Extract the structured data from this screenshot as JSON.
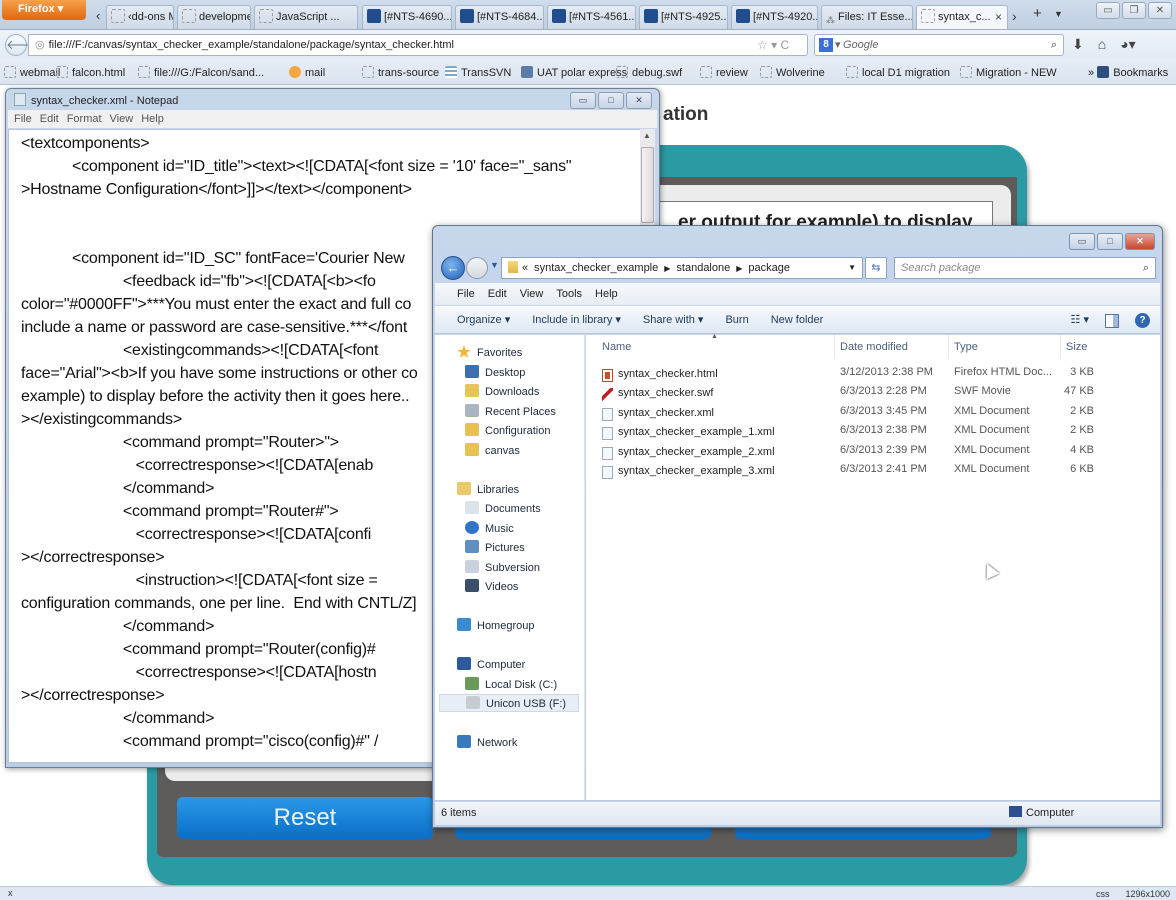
{
  "browser": {
    "menu_button": "Firefox",
    "tabs": [
      {
        "label": "‹dd-ons M...",
        "icon": "blank"
      },
      {
        "label": "developme...",
        "icon": "blank"
      },
      {
        "label": "JavaScript ...",
        "icon": "blank"
      },
      {
        "label": "[#NTS-4690...",
        "icon": "jira"
      },
      {
        "label": "[#NTS-4684...",
        "icon": "jira"
      },
      {
        "label": "[#NTS-4561...",
        "icon": "jira"
      },
      {
        "label": "[#NTS-4925...",
        "icon": "jira"
      },
      {
        "label": "[#NTS-4920...",
        "icon": "jira"
      },
      {
        "label": "Files: IT Esse...",
        "icon": "files"
      },
      {
        "label": "syntax_c...",
        "icon": "blank",
        "active": true
      }
    ],
    "tab_close": "×",
    "url": "file:///F:/canvas/syntax_checker_example/standalone/package/syntax_checker.html",
    "search_placeholder": "Google",
    "bookmarks": [
      {
        "label": "webmail",
        "icon": "blank"
      },
      {
        "label": "falcon.html",
        "icon": "blank"
      },
      {
        "label": "file:///G:/Falcon/sand...",
        "icon": "blank"
      },
      {
        "label": "mail",
        "icon": "colored"
      },
      {
        "label": "trans-source",
        "icon": "blank"
      },
      {
        "label": "TransSVN",
        "icon": "svn"
      },
      {
        "label": "UAT polar express",
        "icon": "uat"
      },
      {
        "label": "debug.swf",
        "icon": "blank"
      },
      {
        "label": "review",
        "icon": "blank"
      },
      {
        "label": "Wolverine",
        "icon": "blank"
      },
      {
        "label": "local D1 migration",
        "icon": "blank"
      },
      {
        "label": "Migration - NEW",
        "icon": "blank"
      }
    ],
    "bookmarks_menu": "Bookmarks",
    "status_left": "x",
    "status_right": [
      "css",
      "1296x1000"
    ]
  },
  "page": {
    "title_fragment": "ation",
    "text_fragment": "er output for example) to display",
    "buttons": [
      "Reset",
      "",
      ""
    ]
  },
  "notepad": {
    "title": "syntax_checker.xml - Notepad",
    "menu": [
      "File",
      "Edit",
      "Format",
      "View",
      "Help"
    ],
    "lines": [
      "<textcomponents>",
      "            <component id=\"ID_title\"><text><![CDATA[<font size = '10' face=\"_sans\"",
      ">Hostname Configuration</font>]]></text></component>",
      "",
      "",
      "            <component id=\"ID_SC\" fontFace='Courier New",
      "                        <feedback id=\"fb\"><![CDATA[<b><fo",
      "color=\"#0000FF\">***You must enter the exact and full co",
      "include a name or password are case-sensitive.***</font",
      "                        <existingcommands><![CDATA[<font",
      "face=\"Arial\"><b>If you have some instructions or other co",
      "example) to display before the activity then it goes here..",
      "></existingcommands>",
      "                        <command prompt=\"Router>\">",
      "                           <correctresponse><![CDATA[enab",
      "                        </command>",
      "                        <command prompt=\"Router#\">",
      "                           <correctresponse><![CDATA[confi",
      "></correctresponse>",
      "                           <instruction><![CDATA[<font size =",
      "configuration commands, one per line.  End with CNTL/Z]",
      "                        </command>",
      "                        <command prompt=\"Router(config)#",
      "                           <correctresponse><![CDATA[hostn",
      "></correctresponse>",
      "                        </command>",
      "                        <command prompt=\"cisco(config)#\" /"
    ]
  },
  "explorer": {
    "breadcrumb": [
      "«",
      "syntax_checker_example",
      "standalone",
      "package"
    ],
    "search_placeholder": "Search package",
    "menu": [
      "File",
      "Edit",
      "View",
      "Tools",
      "Help"
    ],
    "toolbar": [
      "Organize ▾",
      "Include in library ▾",
      "Share with ▾",
      "Burn",
      "New folder"
    ],
    "nav": [
      {
        "label": "Favorites",
        "icon": "star",
        "level": 0
      },
      {
        "label": "Desktop",
        "icon": "desktop",
        "level": 1
      },
      {
        "label": "Downloads",
        "icon": "downloads",
        "level": 1
      },
      {
        "label": "Recent Places",
        "icon": "recent",
        "level": 1
      },
      {
        "label": "Configuration",
        "icon": "folder",
        "level": 1
      },
      {
        "label": "canvas",
        "icon": "folder",
        "level": 1
      },
      {
        "label": "Libraries",
        "icon": "libraries",
        "level": 0,
        "gap": true
      },
      {
        "label": "Documents",
        "icon": "documents",
        "level": 1
      },
      {
        "label": "Music",
        "icon": "music",
        "level": 1
      },
      {
        "label": "Pictures",
        "icon": "pictures",
        "level": 1
      },
      {
        "label": "Subversion",
        "icon": "subversion",
        "level": 1
      },
      {
        "label": "Videos",
        "icon": "videos",
        "level": 1
      },
      {
        "label": "Homegroup",
        "icon": "homegroup",
        "level": 0,
        "gap": true
      },
      {
        "label": "Computer",
        "icon": "computer",
        "level": 0,
        "gap": true
      },
      {
        "label": "Local Disk (C:)",
        "icon": "disk",
        "level": 1
      },
      {
        "label": "Unicon USB  (F:)",
        "icon": "usb",
        "level": 1,
        "selected": true
      },
      {
        "label": "Network",
        "icon": "network",
        "level": 0,
        "gap": true
      }
    ],
    "columns": [
      "Name",
      "Date modified",
      "Type",
      "Size"
    ],
    "files": [
      {
        "name": "syntax_checker.html",
        "date": "3/12/2013 2:38 PM",
        "type": "Firefox HTML Doc...",
        "size": "3 KB",
        "icon": "html"
      },
      {
        "name": "syntax_checker.swf",
        "date": "6/3/2013 2:28 PM",
        "type": "SWF Movie",
        "size": "47 KB",
        "icon": "swf"
      },
      {
        "name": "syntax_checker.xml",
        "date": "6/3/2013 3:45 PM",
        "type": "XML Document",
        "size": "2 KB",
        "icon": "xml"
      },
      {
        "name": "syntax_checker_example_1.xml",
        "date": "6/3/2013 2:38 PM",
        "type": "XML Document",
        "size": "2 KB",
        "icon": "xml"
      },
      {
        "name": "syntax_checker_example_2.xml",
        "date": "6/3/2013 2:39 PM",
        "type": "XML Document",
        "size": "4 KB",
        "icon": "xml"
      },
      {
        "name": "syntax_checker_example_3.xml",
        "date": "6/3/2013 2:41 PM",
        "type": "XML Document",
        "size": "6 KB",
        "icon": "xml"
      }
    ],
    "status_items": "6 items",
    "status_location": "Computer"
  }
}
